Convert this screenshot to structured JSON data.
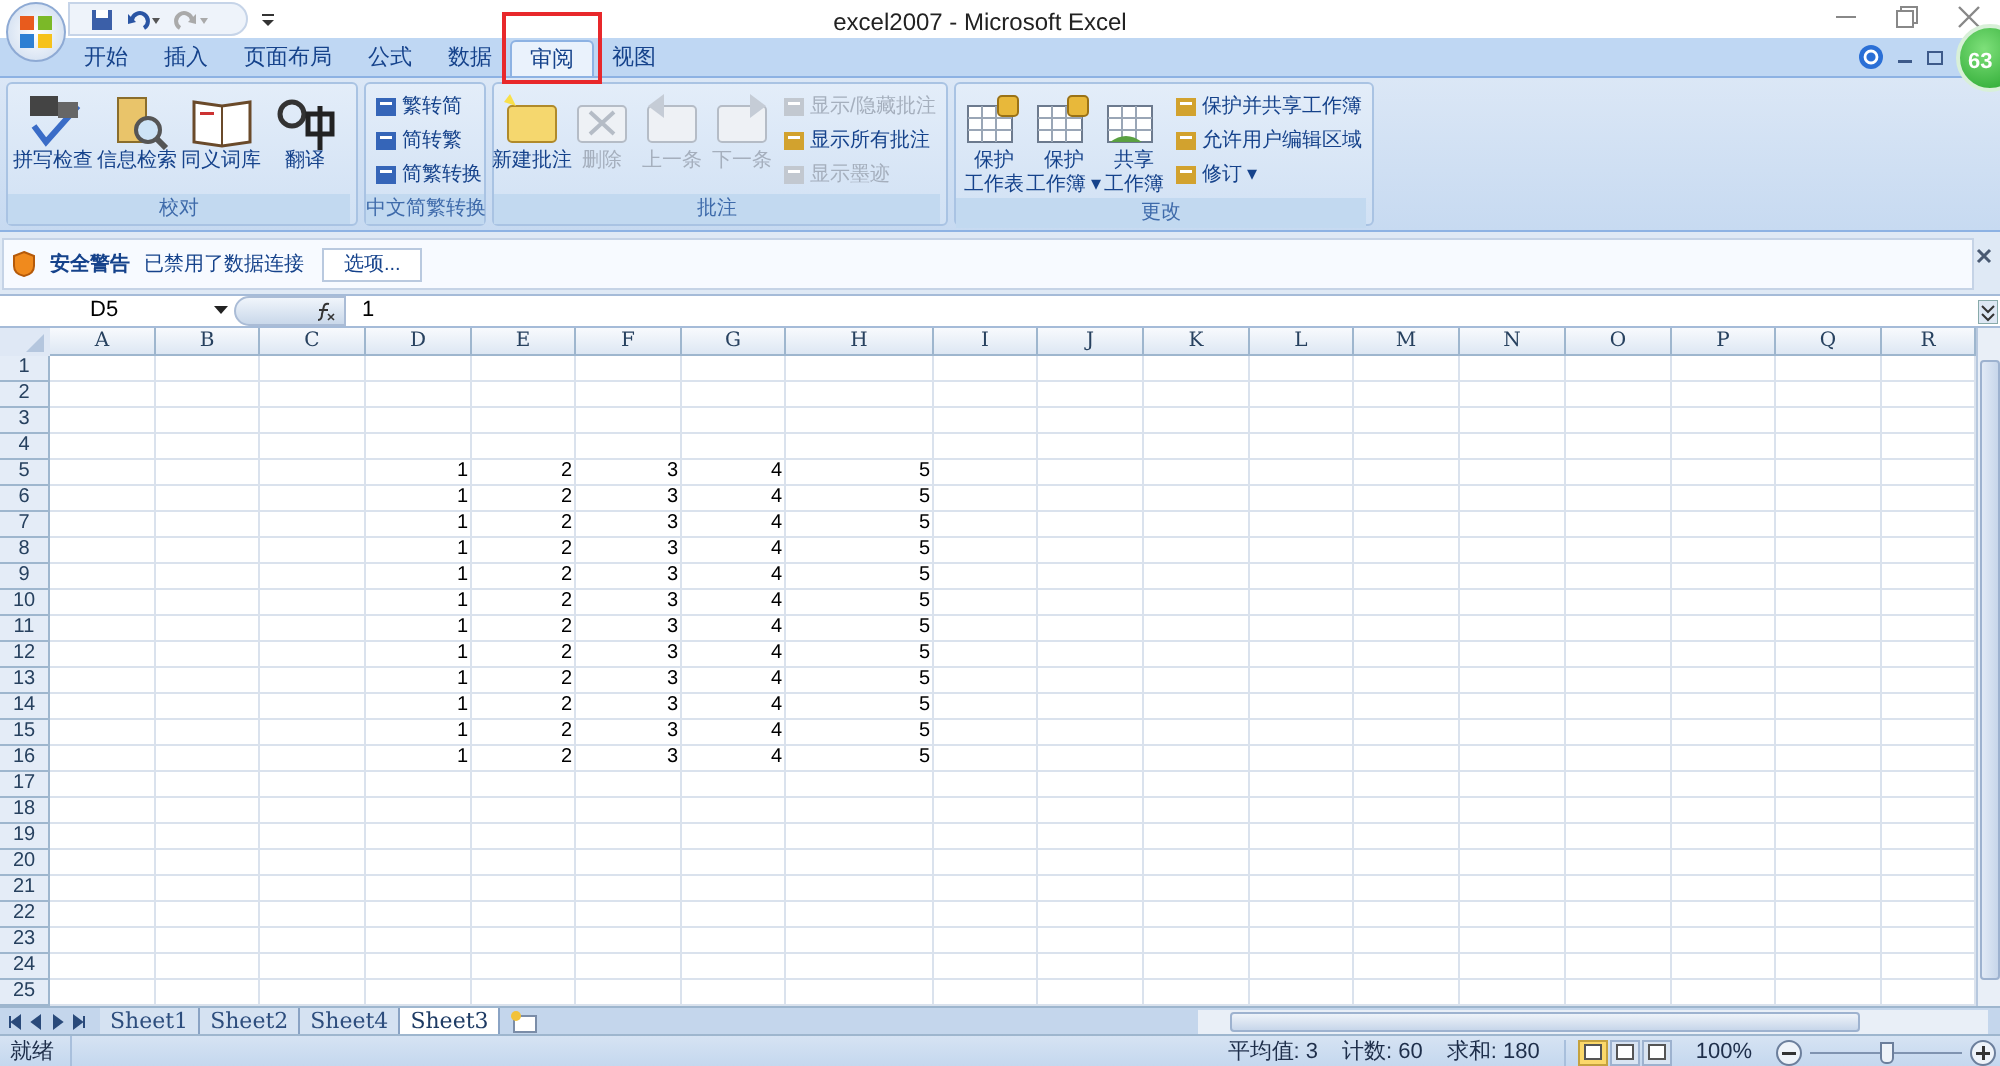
{
  "window": {
    "title": "excel2007 - Microsoft Excel"
  },
  "badge": "63",
  "tabs": [
    {
      "label": "开始",
      "selected": false,
      "annotated": false
    },
    {
      "label": "插入",
      "selected": false,
      "annotated": false
    },
    {
      "label": "页面布局",
      "selected": false,
      "annotated": false
    },
    {
      "label": "公式",
      "selected": false,
      "annotated": false
    },
    {
      "label": "数据",
      "selected": false,
      "annotated": false
    },
    {
      "label": "审阅",
      "selected": true,
      "annotated": true
    },
    {
      "label": "视图",
      "selected": false,
      "annotated": false
    }
  ],
  "ribbon": [
    {
      "label": "校对",
      "items": [
        {
          "kind": "large",
          "label": "拼写检查",
          "disabled": false
        },
        {
          "kind": "large",
          "label": "信息检索",
          "disabled": false
        },
        {
          "kind": "large",
          "label": "同义词库",
          "disabled": false
        },
        {
          "kind": "large",
          "label": "翻译",
          "disabled": false
        }
      ]
    },
    {
      "label": "中文简繁转换",
      "items": [
        {
          "kind": "small",
          "label": "繁转简",
          "disabled": false
        },
        {
          "kind": "small",
          "label": "简转繁",
          "disabled": false
        },
        {
          "kind": "small",
          "label": "简繁转换",
          "disabled": false
        }
      ]
    },
    {
      "label": "批注",
      "items": [
        {
          "kind": "large",
          "label": "新建批注",
          "disabled": false
        },
        {
          "kind": "large",
          "label": "删除",
          "disabled": true
        },
        {
          "kind": "large",
          "label": "上一条",
          "disabled": true
        },
        {
          "kind": "large",
          "label": "下一条",
          "disabled": true
        },
        {
          "kind": "small",
          "label": "显示/隐藏批注",
          "disabled": true
        },
        {
          "kind": "small",
          "label": "显示所有批注",
          "disabled": false
        },
        {
          "kind": "small",
          "label": "显示墨迹",
          "disabled": true
        }
      ]
    },
    {
      "label": "更改",
      "items": [
        {
          "kind": "large",
          "lines": [
            "保护",
            "工作表"
          ],
          "disabled": false
        },
        {
          "kind": "large",
          "lines": [
            "保护",
            "工作簿 ▾"
          ],
          "disabled": false
        },
        {
          "kind": "large",
          "lines": [
            "共享",
            "工作簿"
          ],
          "disabled": false
        },
        {
          "kind": "small",
          "label": "保护并共享工作簿",
          "disabled": false
        },
        {
          "kind": "small",
          "label": "允许用户编辑区域",
          "disabled": false
        },
        {
          "kind": "small",
          "label": "修订 ▾",
          "disabled": false
        }
      ]
    }
  ],
  "security_bar": {
    "title": "安全警告",
    "message": "已禁用了数据连接",
    "button": "选项..."
  },
  "formula_bar": {
    "name_box": "D5",
    "value": "1"
  },
  "columns": [
    "A",
    "B",
    "C",
    "D",
    "E",
    "F",
    "G",
    "H",
    "I",
    "J",
    "K",
    "L",
    "M",
    "N",
    "O",
    "P",
    "Q",
    "R"
  ],
  "rows": [
    {
      "header": "1",
      "cells": []
    },
    {
      "header": "2",
      "cells": []
    },
    {
      "header": "3",
      "cells": []
    },
    {
      "header": "4",
      "cells": []
    },
    {
      "header": "5",
      "cells": [
        "",
        "",
        "",
        "1",
        "2",
        "3",
        "4",
        "5"
      ]
    },
    {
      "header": "6",
      "cells": [
        "",
        "",
        "",
        "1",
        "2",
        "3",
        "4",
        "5"
      ]
    },
    {
      "header": "7",
      "cells": [
        "",
        "",
        "",
        "1",
        "2",
        "3",
        "4",
        "5"
      ]
    },
    {
      "header": "8",
      "cells": [
        "",
        "",
        "",
        "1",
        "2",
        "3",
        "4",
        "5"
      ]
    },
    {
      "header": "9",
      "cells": [
        "",
        "",
        "",
        "1",
        "2",
        "3",
        "4",
        "5"
      ]
    },
    {
      "header": "10",
      "cells": [
        "",
        "",
        "",
        "1",
        "2",
        "3",
        "4",
        "5"
      ]
    },
    {
      "header": "11",
      "cells": [
        "",
        "",
        "",
        "1",
        "2",
        "3",
        "4",
        "5"
      ]
    },
    {
      "header": "12",
      "cells": [
        "",
        "",
        "",
        "1",
        "2",
        "3",
        "4",
        "5"
      ]
    },
    {
      "header": "13",
      "cells": [
        "",
        "",
        "",
        "1",
        "2",
        "3",
        "4",
        "5"
      ]
    },
    {
      "header": "14",
      "cells": [
        "",
        "",
        "",
        "1",
        "2",
        "3",
        "4",
        "5"
      ]
    },
    {
      "header": "15",
      "cells": [
        "",
        "",
        "",
        "1",
        "2",
        "3",
        "4",
        "5"
      ]
    },
    {
      "header": "16",
      "cells": [
        "",
        "",
        "",
        "1",
        "2",
        "3",
        "4",
        "5"
      ]
    },
    {
      "header": "17",
      "cells": []
    },
    {
      "header": "18",
      "cells": []
    },
    {
      "header": "19",
      "cells": []
    },
    {
      "header": "20",
      "cells": []
    },
    {
      "header": "21",
      "cells": []
    },
    {
      "header": "22",
      "cells": []
    },
    {
      "header": "23",
      "cells": []
    },
    {
      "header": "24",
      "cells": []
    },
    {
      "header": "25",
      "cells": []
    }
  ],
  "sheets": [
    {
      "label": "Sheet1",
      "selected": false
    },
    {
      "label": "Sheet2",
      "selected": false
    },
    {
      "label": "Sheet4",
      "selected": false
    },
    {
      "label": "Sheet3",
      "selected": true
    }
  ],
  "status_bar": {
    "state": "就绪",
    "stats": [
      "平均值: 3",
      "计数: 60",
      "求和: 180"
    ],
    "views": [
      {
        "selected": true
      },
      {
        "selected": false
      },
      {
        "selected": false
      }
    ],
    "zoom": "100%",
    "zoom_slider": {
      "level": 0.5
    }
  }
}
